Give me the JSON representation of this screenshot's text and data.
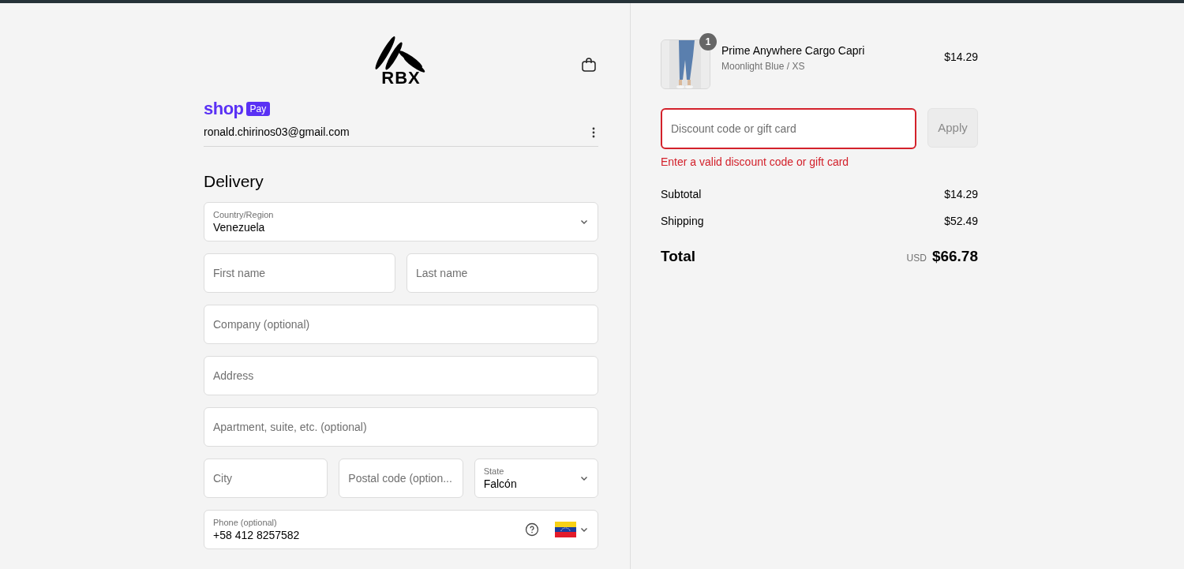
{
  "logo": {
    "text": "RBX"
  },
  "shop_pay": {
    "shop": "shop",
    "pay": "Pay"
  },
  "account": {
    "email": "ronald.chirinos03@gmail.com"
  },
  "delivery": {
    "title": "Delivery",
    "rows": [
      [
        {
          "kind": "select",
          "label": "Country/Region",
          "value": "Venezuela"
        }
      ],
      [
        {
          "kind": "text",
          "placeholder": "First name"
        },
        {
          "kind": "text",
          "placeholder": "Last name"
        }
      ],
      [
        {
          "kind": "text",
          "placeholder": "Company (optional)"
        }
      ],
      [
        {
          "kind": "text",
          "placeholder": "Address"
        }
      ],
      [
        {
          "kind": "text",
          "placeholder": "Apartment, suite, etc. (optional)"
        }
      ],
      [
        {
          "kind": "text",
          "placeholder": "City"
        },
        {
          "kind": "text",
          "placeholder": "Postal code (option..."
        },
        {
          "kind": "select",
          "label": "State",
          "value": "Falcón"
        }
      ],
      [
        {
          "kind": "phone",
          "label": "Phone (optional)",
          "value": "+58 412 8257582"
        }
      ]
    ]
  },
  "cart": {
    "items": [
      {
        "quantity": "1",
        "name": "Prime Anywhere Cargo Capri",
        "variant": "Moonlight Blue / XS",
        "price": "$14.29"
      }
    ]
  },
  "discount": {
    "placeholder": "Discount code or gift card",
    "invalid": true,
    "error": "Enter a valid discount code or gift card",
    "button": "Apply",
    "button_disabled": true
  },
  "summary": {
    "lines": [
      {
        "label": "Subtotal",
        "value": "$14.29"
      },
      {
        "label": "Shipping",
        "value": "$52.49"
      }
    ],
    "total": {
      "label": "Total",
      "currency": "USD",
      "value": "$66.78"
    }
  }
}
